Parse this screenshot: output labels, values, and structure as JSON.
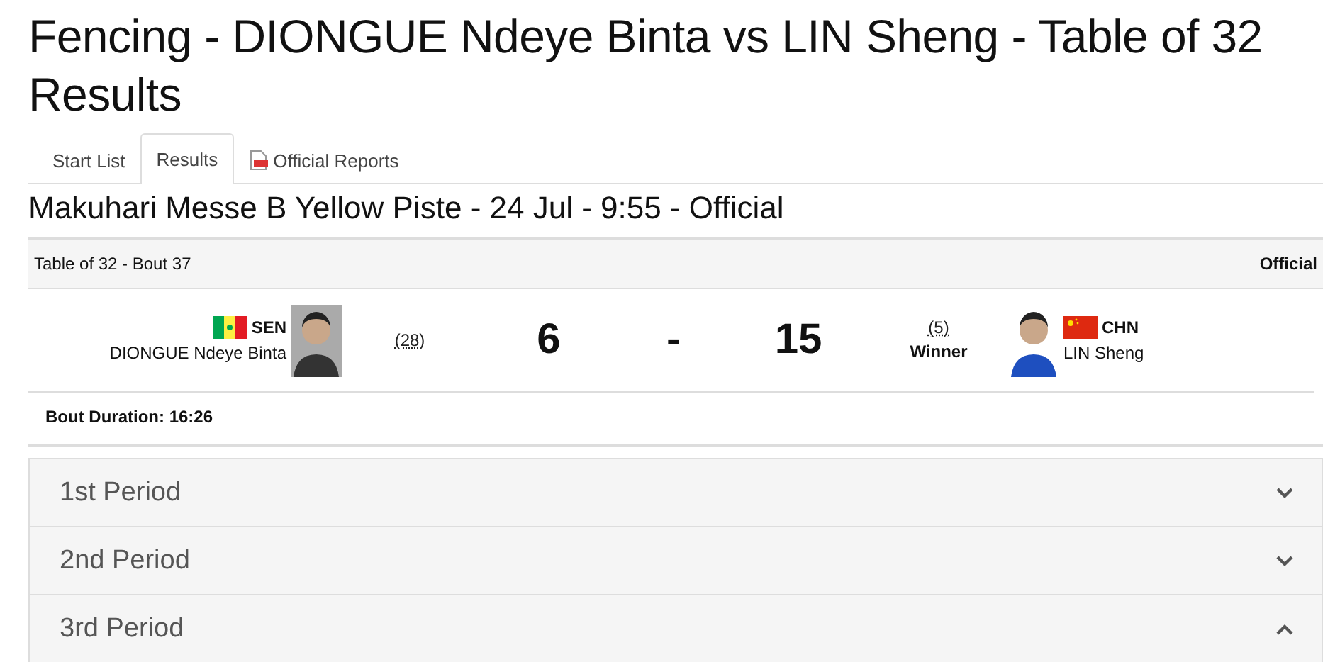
{
  "title": "Fencing - DIONGUE Ndeye Binta vs LIN Sheng - Table of 32 Results",
  "tabs": [
    {
      "label": "Start List",
      "selected": false
    },
    {
      "label": "Results",
      "selected": true
    },
    {
      "label": "Official Reports",
      "selected": false,
      "kind": "report"
    }
  ],
  "venue": "Makuhari Messe B Yellow Piste - 24 Jul - 9:55 - Official",
  "bout": {
    "label": "Table of 32 - Bout 37",
    "status": "Official"
  },
  "players": [
    {
      "noc": "SEN",
      "name": "DIONGUE Ndeye Binta",
      "seed": "(28)",
      "score": "6"
    },
    {
      "noc": "CHN",
      "name": "LIN Sheng",
      "seed": "(5)",
      "score": "15",
      "result": "Winner"
    }
  ],
  "separator": "-",
  "duration": "Bout Duration: 16:26",
  "periods": [
    {
      "label": "1st Period",
      "expanded": false
    },
    {
      "label": "2nd Period",
      "expanded": false
    },
    {
      "label": "3rd Period",
      "expanded": true
    }
  ]
}
